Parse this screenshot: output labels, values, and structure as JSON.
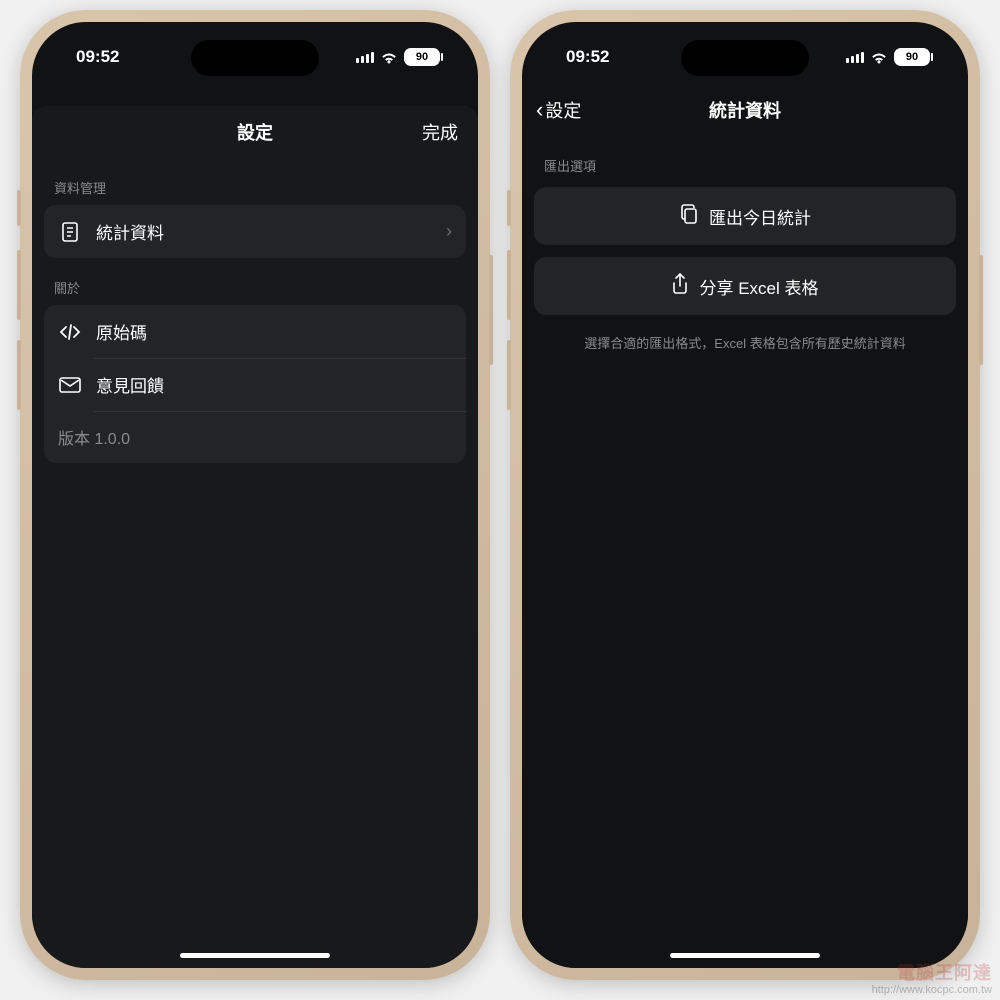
{
  "status": {
    "time": "09:52",
    "battery": "90"
  },
  "left_screen": {
    "nav": {
      "title": "設定",
      "done": "完成"
    },
    "section_data": "資料管理",
    "row_stats": "統計資料",
    "section_about": "關於",
    "row_source": "原始碼",
    "row_feedback": "意見回饋",
    "row_version": "版本 1.0.0"
  },
  "right_screen": {
    "nav": {
      "back": "設定",
      "title": "統計資料"
    },
    "section_export": "匯出選項",
    "btn_export_today": "匯出今日統計",
    "btn_share_excel": "分享 Excel 表格",
    "hint": "選擇合適的匯出格式，Excel 表格包含所有歷史統計資料"
  },
  "watermark": {
    "brand": "電腦王阿達",
    "url": "http://www.kocpc.com.tw"
  }
}
